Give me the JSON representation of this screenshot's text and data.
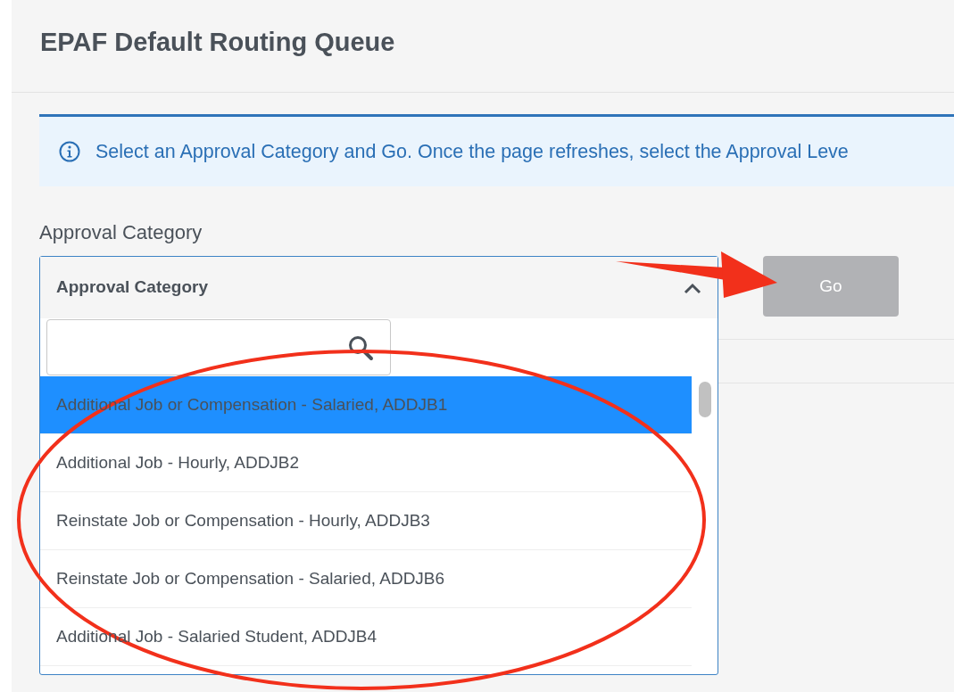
{
  "page": {
    "title": "EPAF Default Routing Queue"
  },
  "alert": {
    "text": "Select an Approval Category and Go. Once the page refreshes, select the Approval Leve"
  },
  "field": {
    "label": "Approval Category",
    "dropdown": {
      "header": "Approval Category",
      "expanded": true,
      "options": [
        {
          "label": "Additional Job or Compensation - Salaried, ADDJB1",
          "selected": true
        },
        {
          "label": "Additional Job - Hourly, ADDJB2",
          "selected": false
        },
        {
          "label": "Reinstate Job or Compensation - Hourly, ADDJB3",
          "selected": false
        },
        {
          "label": "Reinstate Job or Compensation - Salaried, ADDJB6",
          "selected": false
        },
        {
          "label": "Additional Job - Salaried Student, ADDJB4",
          "selected": false
        }
      ]
    }
  },
  "go_button": {
    "label": "Go",
    "disabled": true
  }
}
